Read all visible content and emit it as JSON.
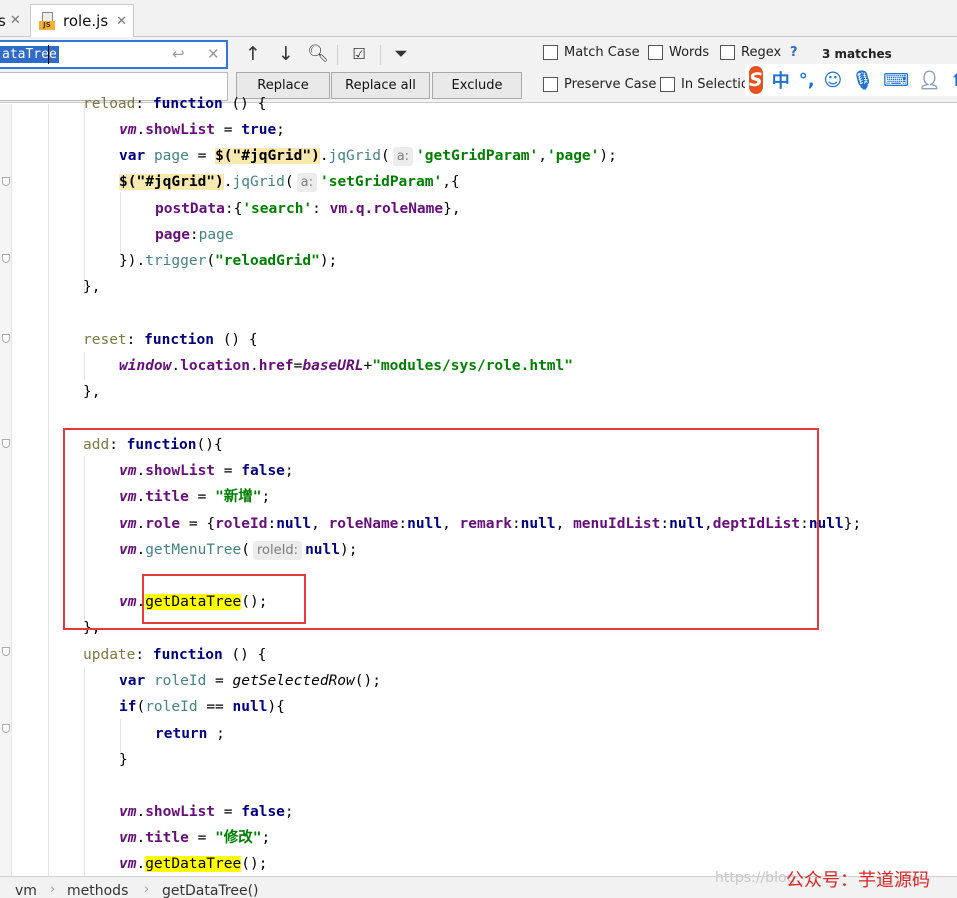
{
  "tabs": {
    "prev_tab_label": "s",
    "active_tab_label": "role.js",
    "file_badge": "JS",
    "close_glyph": "✕"
  },
  "find": {
    "query": "ataTree",
    "replace_value": "",
    "replace_label": "Replace",
    "replace_all_label": "Replace all",
    "exclude_label": "Exclude",
    "options": {
      "match_case": "Match Case",
      "words": "Words",
      "regex": "Regex",
      "preserve_case": "Preserve Case",
      "in_selection": "In Selection"
    },
    "help": "?",
    "matches": "3 matches",
    "icons": {
      "newline": "newline-icon",
      "clear": "clear-icon",
      "prev_match": "arrow-up-icon",
      "next_match": "arrow-down-icon",
      "select_all": "select-all-occurrences-icon",
      "select_in_editor": "select-occurrences-icon",
      "filter": "filter-icon"
    }
  },
  "ime": {
    "logo": "S",
    "lang": "中",
    "punct": "°,"
  },
  "code": {
    "l0_key": "reload",
    "l0_kw": "function",
    "l0_rest": " () {",
    "vm": "vm",
    "showList": "showList",
    "title": "title",
    "role": "role",
    "eq": " = ",
    "true": "true",
    "false": "false",
    "semi": ";",
    "var": "var",
    "page": "page",
    "jq_sel": "$(\"#jqGrid\")",
    "jqGrid": "jqGrid",
    "hint_a": "a:",
    "getGridParam": "'getGridParam'",
    "page_str": "'page'",
    "setGridParam": "'setGridParam'",
    "postData": "postData",
    "search_str": "'search'",
    "q_roleName": "vm.q.roleName",
    "trigger": "trigger",
    "reloadGrid": "\"reloadGrid\"",
    "close_obj": "}",
    "reset_key": "reset",
    "window": "window",
    "location": "location",
    "href": "href",
    "baseURL": "baseURL",
    "role_url": "\"modules/sys/role.html\"",
    "add_key": "add",
    "xin_zeng": "\"新增\"",
    "roleId": "roleId",
    "roleName": "roleName",
    "remark": "remark",
    "menuIdList": "menuIdList",
    "deptIdList": "deptIdList",
    "null": "null",
    "getMenuTree": "getMenuTree",
    "hint_roleId": "roleId:",
    "getDataTree": "getDataTree",
    "update_key": "update",
    "getSelectedRow": "getSelectedRow",
    "if": "if",
    "return": "return",
    "xiu_gai": "\"修改\""
  },
  "breadcrumb": {
    "items": [
      "vm",
      "methods",
      "getDataTree()"
    ],
    "separator": "›"
  },
  "watermark": {
    "url": "https://blog",
    "text": "公众号：芋道源码"
  },
  "colors": {
    "keyword": "#000080",
    "string": "#008000",
    "property": "#660e7a",
    "highlight": "#ffff00",
    "annotation_box": "#e33a3a",
    "search_selection": "#2f6bc8"
  }
}
